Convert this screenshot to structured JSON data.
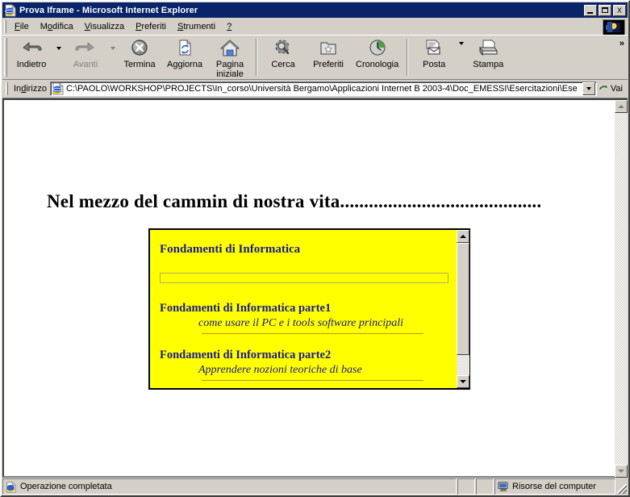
{
  "window": {
    "title": "Prova Iframe - Microsoft Internet Explorer",
    "icon": "ie-document-icon",
    "controls": {
      "minimize": "minimize-button",
      "maximize": "maximize-button",
      "close_label": "X"
    }
  },
  "menubar": {
    "items": [
      {
        "label": "File",
        "accel": "F"
      },
      {
        "label": "Modifica",
        "accel": "M"
      },
      {
        "label": "Visualizza",
        "accel": "V"
      },
      {
        "label": "Preferiti",
        "accel": "P"
      },
      {
        "label": "Strumenti",
        "accel": "S"
      },
      {
        "label": "?",
        "accel": ""
      }
    ],
    "logo": "ie-animated-logo"
  },
  "toolbar": {
    "overflow_label": "»",
    "buttons": [
      {
        "label": "Indietro",
        "icon": "back-arrow-icon",
        "disabled": false,
        "dropdown": true
      },
      {
        "label": "Avanti",
        "icon": "forward-arrow-icon",
        "disabled": true,
        "dropdown": true
      },
      {
        "label": "Termina",
        "icon": "stop-icon",
        "disabled": false,
        "dropdown": false
      },
      {
        "label": "Aggiorna",
        "icon": "refresh-icon",
        "disabled": false,
        "dropdown": false
      },
      {
        "label": "Pagina\niniziale",
        "icon": "home-icon",
        "disabled": false,
        "dropdown": false
      },
      {
        "label": "Cerca",
        "icon": "search-icon",
        "disabled": false,
        "dropdown": false
      },
      {
        "label": "Preferiti",
        "icon": "favorites-folder-icon",
        "disabled": false,
        "dropdown": false
      },
      {
        "label": "Cronologia",
        "icon": "history-clock-icon",
        "disabled": false,
        "dropdown": false
      },
      {
        "label": "Posta",
        "icon": "mail-icon",
        "disabled": false,
        "dropdown": true
      },
      {
        "label": "Stampa",
        "icon": "printer-icon",
        "disabled": false,
        "dropdown": false
      }
    ]
  },
  "address_bar": {
    "label": "Indirizzo",
    "icon": "ie-document-icon",
    "value": "C:\\PAOLO\\WORKSHOP\\PROJECTS\\In_corso\\Università Bergamo\\Applicazioni Internet B 2003-4\\Doc_EMESSI\\Esercitazioni\\Ese",
    "dropdown_icon": "chevron-down-icon",
    "go_label": "Vai",
    "go_icon": "go-arrow-icon"
  },
  "page": {
    "headline": "Nel mezzo del cammin di nostra vita..........................................",
    "iframe": {
      "background_color": "#ffff00",
      "text_color": "#1b1b8f",
      "title": "Fondamenti di Informatica",
      "input_value": "",
      "entries": [
        {
          "heading": "Fondamenti di Informatica parte1",
          "subtitle": "come usare il PC e i tools software principali"
        },
        {
          "heading": "Fondamenti di Informatica parte2",
          "subtitle": "Apprendere nozioni teoriche di base"
        }
      ],
      "scrollbar": {
        "up_icon": "scroll-up-arrow-icon",
        "down_icon": "scroll-down-arrow-icon"
      }
    },
    "scrollbar": {
      "up_icon": "scroll-up-arrow-icon",
      "down_icon": "scroll-down-arrow-icon",
      "disabled": true
    }
  },
  "statusbar": {
    "message": "Operazione completata",
    "message_icon": "ie-document-icon",
    "zone": "Risorse del computer",
    "zone_icon": "computer-monitor-icon"
  }
}
